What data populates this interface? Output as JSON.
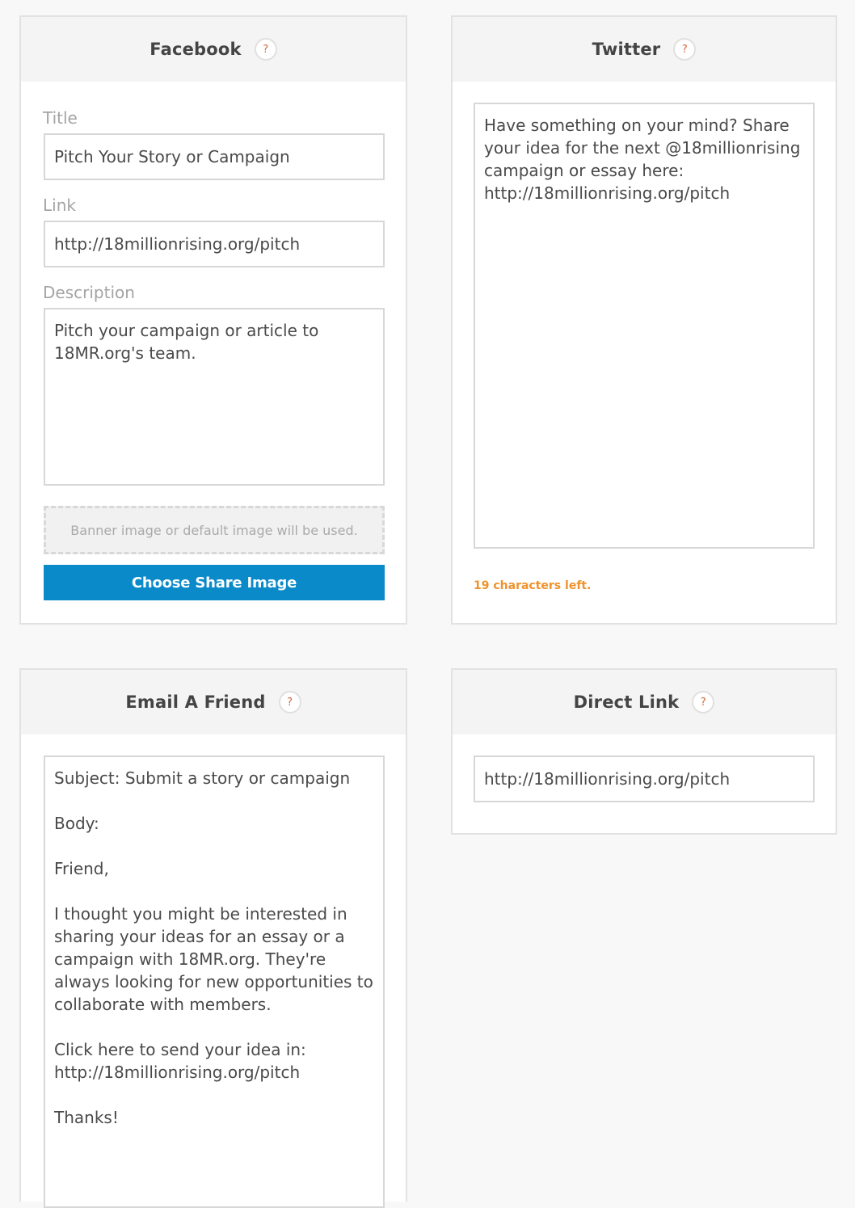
{
  "facebook": {
    "title": "Facebook",
    "help_label": "?",
    "title_label": "Title",
    "title_value": "Pitch Your Story or Campaign",
    "link_label": "Link",
    "link_value": "http://18millionrising.org/pitch",
    "description_label": "Description",
    "description_value": "Pitch your campaign or article to 18MR.org's team.",
    "image_placeholder": "Banner image or default image will be used.",
    "choose_image_label": "Choose Share Image"
  },
  "twitter": {
    "title": "Twitter",
    "help_label": "?",
    "tweet_value": "Have something on your mind? Share your idea for the next @18millionrising campaign or essay here: http://18millionrising.org/pitch",
    "chars_left": "19 characters left."
  },
  "email": {
    "title": "Email A Friend",
    "help_label": "?",
    "body_value": "Subject: Submit a story or campaign\n\nBody:\n\nFriend,\n\nI thought you might be interested in sharing your ideas for an essay or a campaign with 18MR.org. They're always looking for new opportunities to collaborate with members.\n\nClick here to send your idea in: http://18millionrising.org/pitch\n\nThanks!"
  },
  "direct_link": {
    "title": "Direct Link",
    "help_label": "?",
    "link_value": "http://18millionrising.org/pitch"
  },
  "colors": {
    "accent_blue": "#0a8ac9",
    "counter_orange": "#f0922c",
    "help_orange": "#d4683a"
  }
}
